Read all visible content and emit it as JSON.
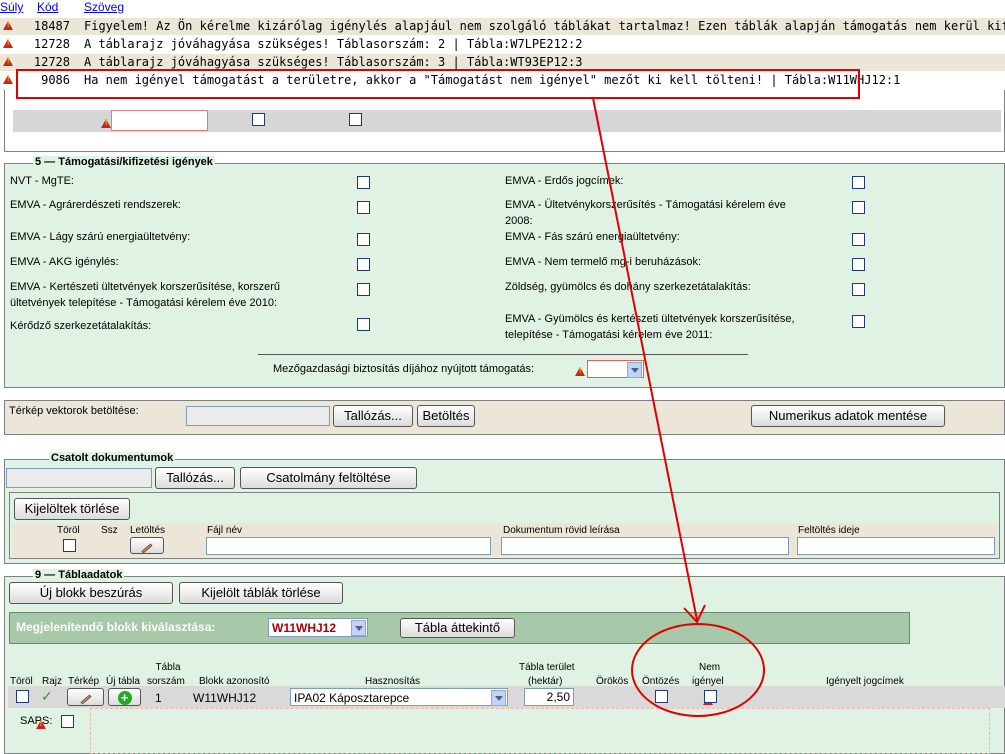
{
  "error_list": {
    "headers": {
      "weight": "Súly",
      "code": "Kód",
      "text": "Szöveg"
    },
    "rows": [
      {
        "code": "18487",
        "text": "Figyelem! Az Ön kérelme kizárólag igénylés alapjául nem szolgáló táblákat tartalmaz! Ezen táblák alapján támogatás nem kerül kifizetésre Önnek"
      },
      {
        "code": "12728",
        "text": "A táblarajz jóváhagyása szükséges! Táblasorszám: 2 | Tábla:W7LPE212:2"
      },
      {
        "code": "12728",
        "text": "A táblarajz jóváhagyása szükséges! Táblasorszám: 3 | Tábla:WT93EP12:3"
      },
      {
        "code": "9086",
        "text": "Ha nem igényel támogatást a területre, akkor a \"Támogatást nem igényel\" mezőt ki kell tölteni! | Tábla:W11WHJ12:1"
      }
    ],
    "highlight_color": "#e00000"
  },
  "section5": {
    "number": "5",
    "title": "Támogatási/kifizetési igények",
    "left_items": [
      "NVT - MgTE:",
      "EMVA - Agrárerdészeti rendszerek:",
      "EMVA - Lágy szárú energiaültetvény:",
      "EMVA - AKG igénylés:",
      "EMVA - Kertészeti ültetvények korszerűsítése, korszerű",
      "ültetvények telepítése - Támogatási kérelem éve 2010:",
      "Kérődző szerkezetátalakítás:"
    ],
    "right_items": [
      "EMVA - Erdős jogcímek:",
      "EMVA - Ültetvénykorszerűsítés - Támogatási kérelem éve",
      "2008:",
      "EMVA - Fás szárú energiaültetvény:",
      "EMVA - Nem termelő mg-i beruházások:",
      "Zöldség, gyümölcs és dohány szerkezetátalakítás:",
      "EMVA - Gyümölcs és kertészeti ültetvények korszerűsítése,",
      "telepítése - Támogatási kérelem éve 2011:"
    ],
    "insurance_label": "Mezőgazdasági biztosítás díjához nyújtott támogatás:"
  },
  "vector_map": {
    "label": "Térkép vektorok betöltése:",
    "browse": "Tallózás...",
    "load": "Betöltés",
    "save": "Numerikus adatok mentése"
  },
  "attachments": {
    "title": "Csatolt dokumentumok",
    "browse": "Tallózás...",
    "upload": "Csatolmány feltöltése",
    "delete_selected": "Kijelöltek törlése",
    "columns": [
      "Töröl",
      "Ssz",
      "Letöltés",
      "Fájl név",
      "Dokumentum rövid leírása",
      "Feltöltés ideje"
    ]
  },
  "section9": {
    "number": "9",
    "title": "Táblaadatok",
    "new_block": "Új blokk beszúrás",
    "delete_tables": "Kijelölt táblák törlése",
    "block_select_label": "Megjelenítendő blokk kiválasztása:",
    "block_value": "W11WHJ12",
    "overview": "Tábla áttekintő",
    "headers": {
      "torol": "Töröl",
      "rajz": "Rajz",
      "terkep": "Térkép",
      "uj_tabla": "Új tábla",
      "tabla1": "Tábla",
      "tabla2": "sorszám",
      "blokk": "Blokk azonosító",
      "hasznositas": "Hasznosítás",
      "terulet1": "Tábla terület",
      "terulet2": "(hektár)",
      "orokos": "Örökös",
      "ontozes": "Öntözés",
      "nem1": "Nem",
      "nem2": "igényel",
      "jogcimek": "Igényelt jogcímek"
    },
    "row": {
      "sorszam": "1",
      "blokk": "W11WHJ12",
      "hasznositas": "IPA02 Káposztarepce",
      "terulet": "2,50",
      "rajz": "✓"
    },
    "saps_label": "SAPS:"
  }
}
